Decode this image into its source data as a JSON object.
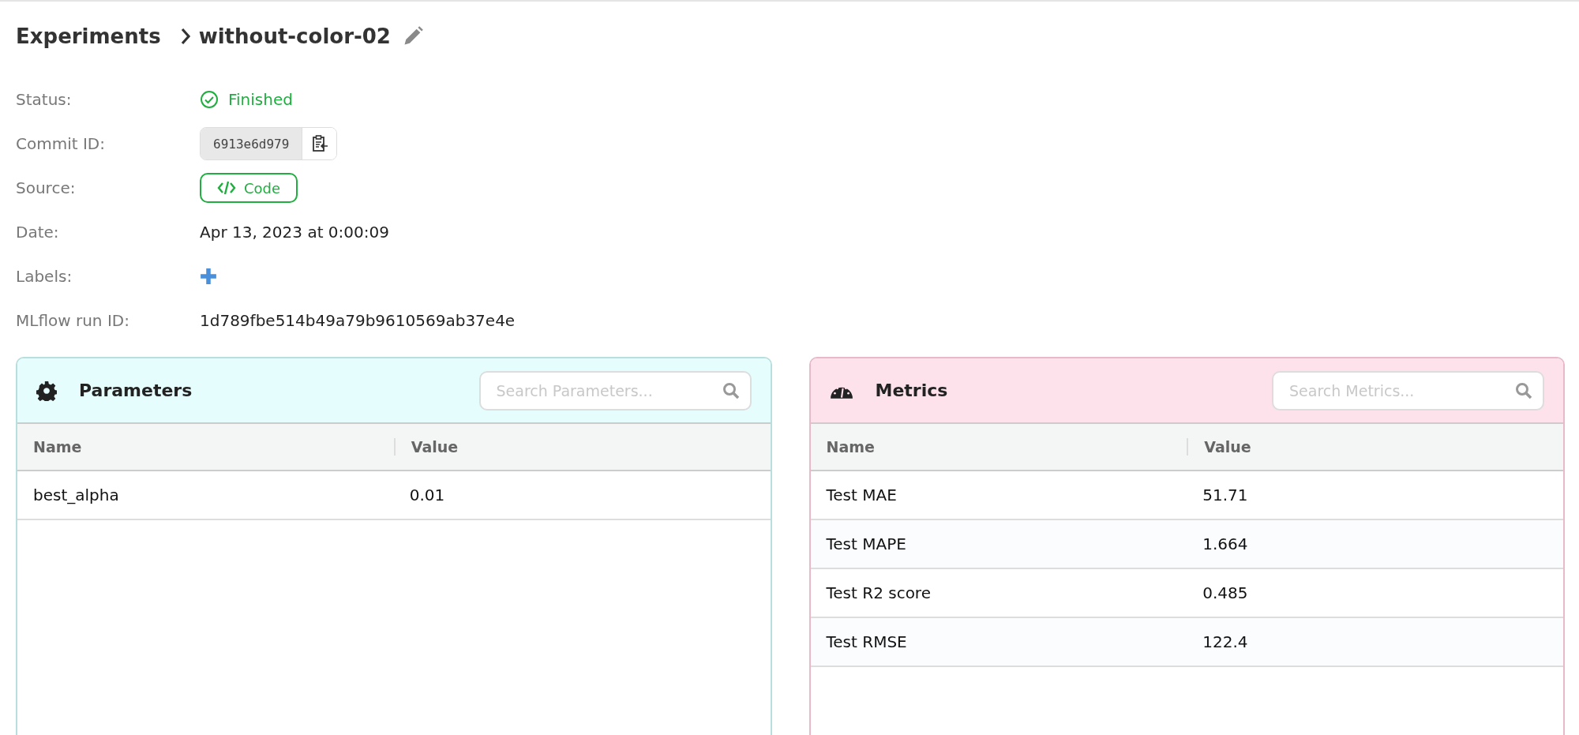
{
  "breadcrumb": {
    "parent": "Experiments",
    "title": "without-color-02"
  },
  "details": [
    {
      "label": "Status:",
      "kind": "status",
      "value": "Finished"
    },
    {
      "label": "Commit ID:",
      "kind": "commit",
      "value": "6913e6d979"
    },
    {
      "label": "Source:",
      "kind": "source",
      "value": "Code"
    },
    {
      "label": "Date:",
      "kind": "text",
      "value": "Apr 13, 2023 at 0:00:09"
    },
    {
      "label": "Labels:",
      "kind": "add"
    },
    {
      "label": "MLflow run ID:",
      "kind": "text",
      "value": "1d789fbe514b49a79b9610569ab37e4e"
    }
  ],
  "panels": [
    {
      "kind": "parameters",
      "title": "Parameters",
      "search": {
        "placeholder": "Search Parameters..."
      },
      "columns": [
        "Name",
        "Value"
      ],
      "rows": [
        [
          "best_alpha",
          "0.01"
        ]
      ]
    },
    {
      "kind": "metrics",
      "title": "Metrics",
      "search": {
        "placeholder": "Search Metrics..."
      },
      "columns": [
        "Name",
        "Value"
      ],
      "rows": [
        [
          "Test MAE",
          "51.71"
        ],
        [
          "Test MAPE",
          "1.664"
        ],
        [
          "Test R2 score",
          "0.485"
        ],
        [
          "Test RMSE",
          "122.4"
        ]
      ]
    }
  ]
}
